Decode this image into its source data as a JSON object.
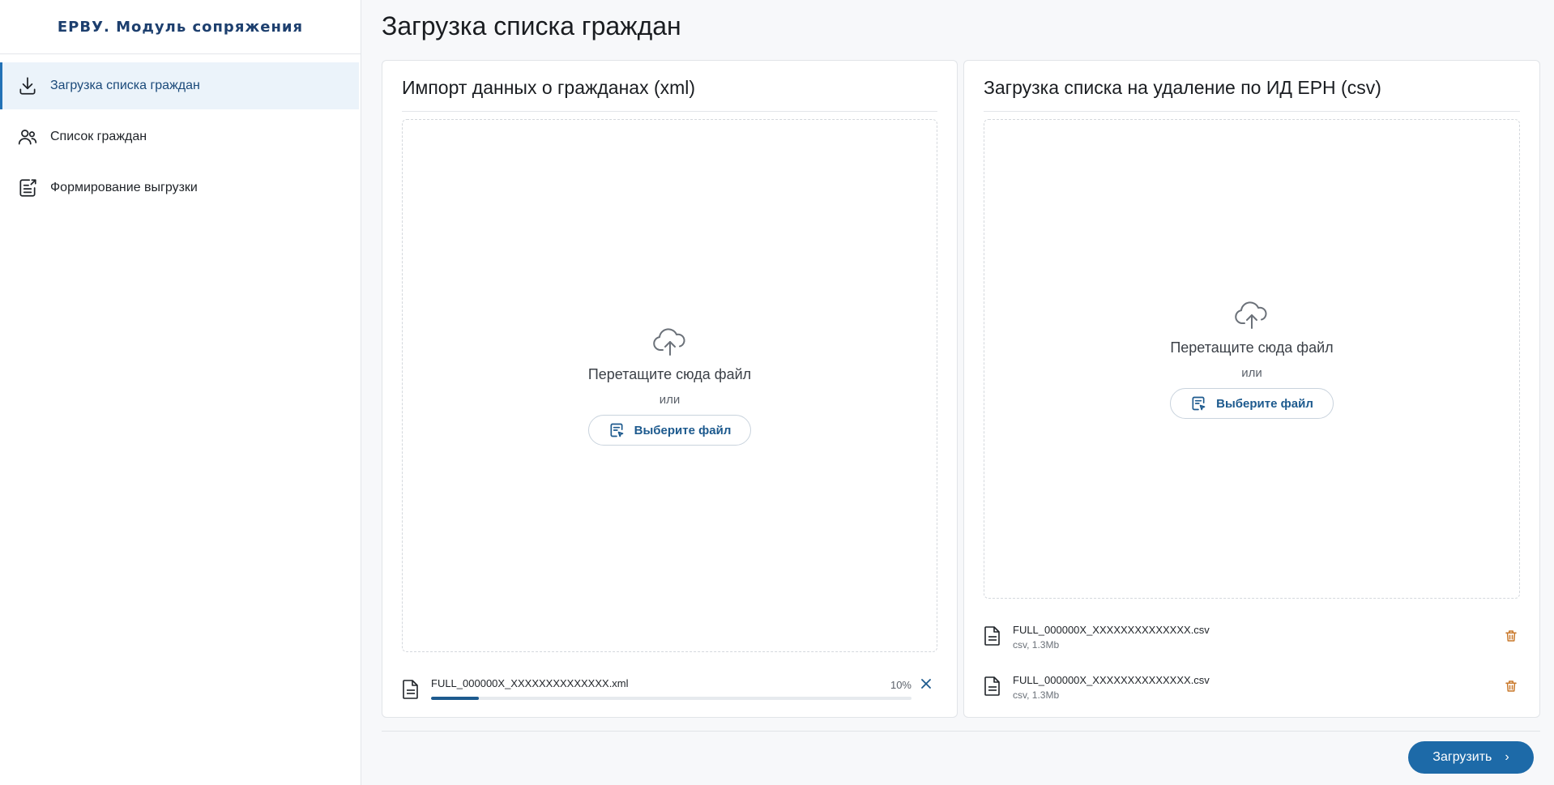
{
  "app": {
    "title": "ЕРВУ. Модуль сопряжения"
  },
  "sidebar": {
    "items": [
      {
        "label": "Загрузка списка граждан",
        "icon": "download-icon",
        "active": true
      },
      {
        "label": "Список граждан",
        "icon": "users-icon",
        "active": false
      },
      {
        "label": "Формирование выгрузки",
        "icon": "export-document-icon",
        "active": false
      }
    ]
  },
  "page": {
    "title": "Загрузка списка граждан"
  },
  "xml_panel": {
    "title": "Импорт данных о гражданах (xml)",
    "drop_text": "Перетащите сюда файл",
    "or_text": "или",
    "choose_label": "Выберите файл",
    "upload": {
      "file_name": "FULL_000000X_XXXXXXXXXXXXXX.xml",
      "progress_percent": 10,
      "progress_label": "10%"
    }
  },
  "csv_panel": {
    "title": "Загрузка списка на удаление по ИД ЕРН (csv)",
    "drop_text": "Перетащите сюда файл",
    "or_text": "или",
    "choose_label": "Выберите файл",
    "files": [
      {
        "name": "FULL_000000X_XXXXXXXXXXXXXX.csv",
        "meta": "csv, 1.3Mb"
      },
      {
        "name": "FULL_000000X_XXXXXXXXXXXXXX.csv",
        "meta": "csv, 1.3Mb"
      }
    ]
  },
  "actions": {
    "submit_label": "Загрузить"
  },
  "colors": {
    "accent": "#1d6aa8",
    "accent_dark": "#1d3f6e",
    "active_bg": "#ebf3fa",
    "danger": "#c9782a"
  }
}
